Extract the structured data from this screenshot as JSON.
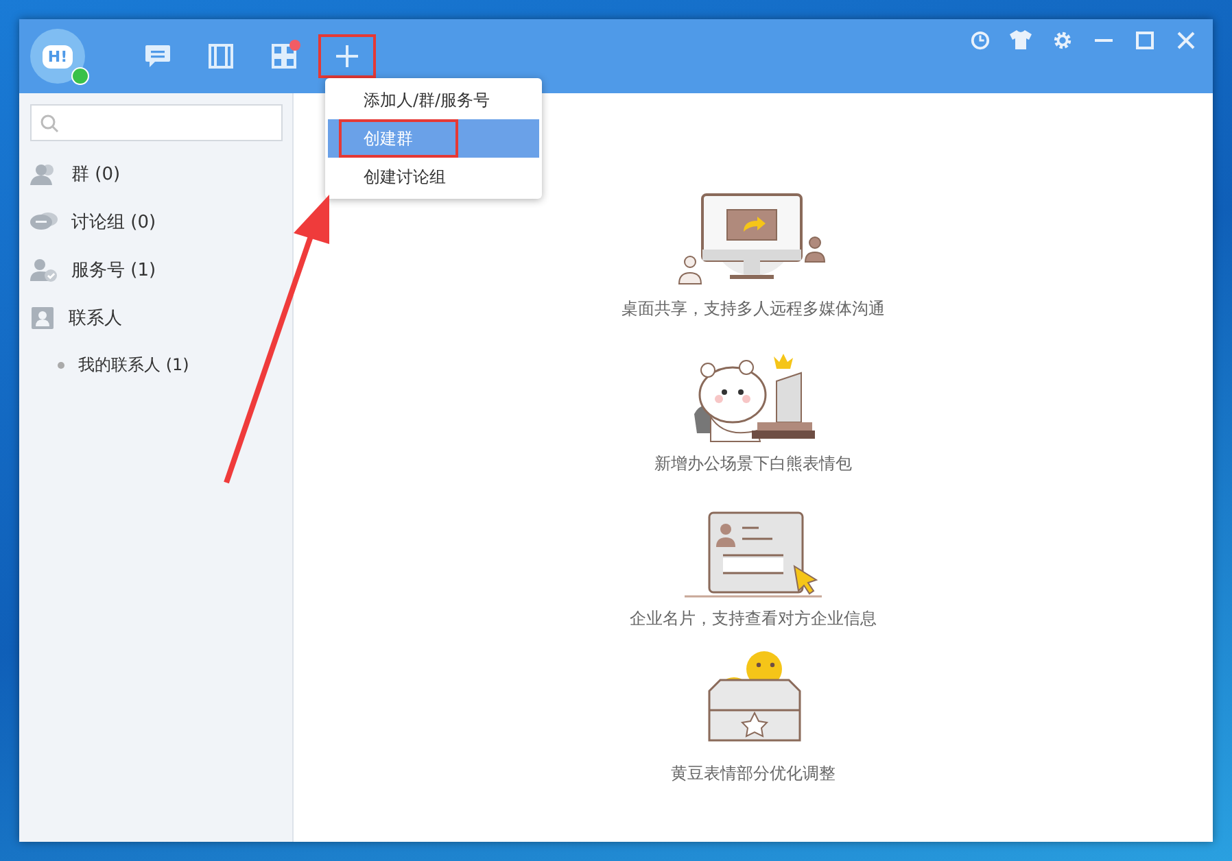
{
  "header": {
    "avatar_text": "H!",
    "online": true,
    "tools": [
      {
        "kind": "chat",
        "badge": false,
        "highlighted": false
      },
      {
        "kind": "contacts",
        "badge": false,
        "highlighted": false
      },
      {
        "kind": "apps",
        "badge": true,
        "highlighted": false
      },
      {
        "kind": "add",
        "badge": false,
        "highlighted": true
      }
    ],
    "window_controls": [
      {
        "kind": "history"
      },
      {
        "kind": "skin"
      },
      {
        "kind": "settings"
      },
      {
        "kind": "minimize"
      },
      {
        "kind": "maximize"
      },
      {
        "kind": "close"
      }
    ]
  },
  "add_menu": {
    "items": [
      {
        "label": "添加人/群/服务号",
        "selected": false,
        "highlighted": false
      },
      {
        "label": "创建群",
        "selected": true,
        "highlighted": true
      },
      {
        "label": "创建讨论组",
        "selected": false,
        "highlighted": false
      }
    ]
  },
  "sidebar": {
    "items": [
      {
        "kind": "group",
        "label": "群 (0)"
      },
      {
        "kind": "discussion",
        "label": "讨论组 (0)"
      },
      {
        "kind": "service",
        "label": "服务号 (1)"
      },
      {
        "kind": "contacts",
        "label": "联系人",
        "children": [
          {
            "label": "我的联系人 (1)"
          }
        ]
      }
    ]
  },
  "features": [
    {
      "kind": "screen-share",
      "caption": "桌面共享，支持多人远程多媒体沟通"
    },
    {
      "kind": "bear",
      "caption": "新增办公场景下白熊表情包"
    },
    {
      "kind": "card",
      "caption": "企业名片，支持查看对方企业信息"
    },
    {
      "kind": "emoji-box",
      "caption": "黄豆表情部分优化调整"
    }
  ]
}
